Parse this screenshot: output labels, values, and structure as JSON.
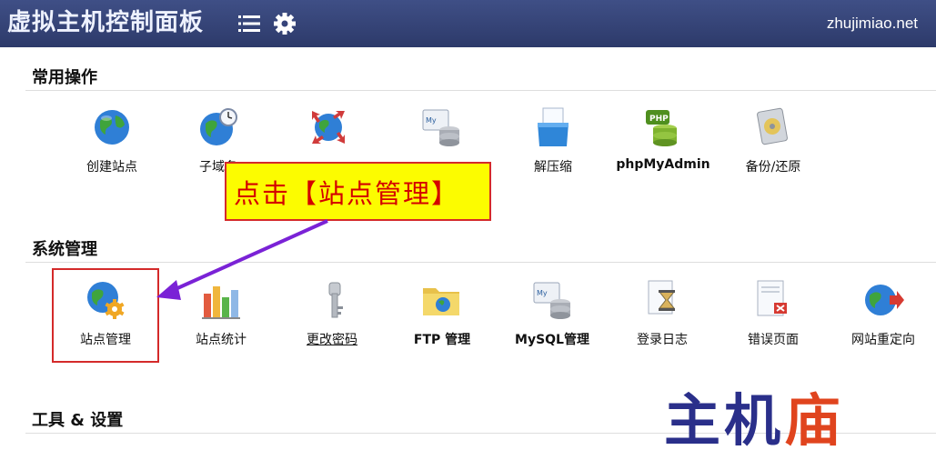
{
  "header": {
    "title": "虚拟主机控制面板",
    "domain": "zhujimiao.net",
    "menu_icon": "hamburger-menu-icon",
    "settings_icon": "gear-icon"
  },
  "sections": {
    "common": {
      "title": "常用操作",
      "items": [
        {
          "label": "创建站点",
          "icon": "globe-icon"
        },
        {
          "label": "子域名",
          "icon": "globe-clock-icon"
        },
        {
          "label": "",
          "icon": "globe-arrows-icon"
        },
        {
          "label": "",
          "icon": "mysql-database-icon"
        },
        {
          "label": "解压缩",
          "icon": "archive-icon"
        },
        {
          "label": "phpMyAdmin",
          "icon": "php-database-icon"
        },
        {
          "label": "备份/还原",
          "icon": "backup-disk-icon"
        }
      ]
    },
    "system": {
      "title": "系统管理",
      "items": [
        {
          "label": "站点管理",
          "icon": "globe-gear-icon"
        },
        {
          "label": "站点统计",
          "icon": "bar-chart-icon"
        },
        {
          "label": "更改密码",
          "icon": "key-icon"
        },
        {
          "label": "FTP 管理",
          "icon": "folder-globe-icon"
        },
        {
          "label": "MySQL管理",
          "icon": "mysql-database-icon"
        },
        {
          "label": "登录日志",
          "icon": "hourglass-doc-icon"
        },
        {
          "label": "错误页面",
          "icon": "error-page-icon"
        },
        {
          "label": "网站重定向",
          "icon": "globe-redirect-icon"
        }
      ]
    },
    "tools": {
      "title": "工具 & 设置"
    }
  },
  "annotation": {
    "callout": "点击【站点管理】"
  },
  "watermark": {
    "text_main": "主机",
    "text_accent": "庙"
  }
}
